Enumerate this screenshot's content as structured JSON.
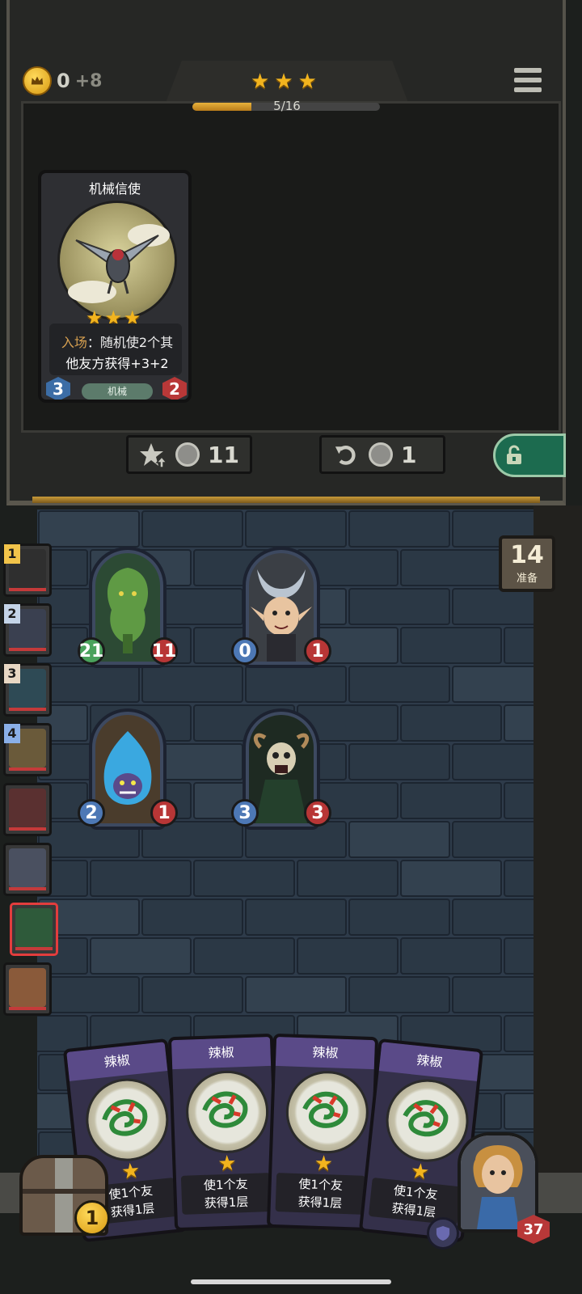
{
  "header": {
    "gold_current": "0",
    "gold_income": "+8",
    "tier_stars": 3,
    "tier_progress_text": "5/16",
    "tier_progress_fraction": 0.3125
  },
  "featured_card": {
    "name": "机械信使",
    "stars": 3,
    "desc_keyword": "入场",
    "desc_line1_rest": "：随机使2个其",
    "desc_line2": "他友方获得+3+2",
    "tribe": "机械",
    "attack": "3",
    "health": "2"
  },
  "shop_buttons": {
    "upgrade_cost": "11",
    "refresh_cost": "1"
  },
  "board": {
    "minions": [
      {
        "attack": "21",
        "health": "11",
        "art": "tree-monster"
      },
      {
        "attack": "0",
        "health": "1",
        "art": "horned-elf"
      },
      {
        "attack": "2",
        "health": "1",
        "art": "blue-flame-demon"
      },
      {
        "attack": "3",
        "health": "3",
        "art": "skull-reaper"
      }
    ],
    "prep_count": "14",
    "prep_label": "准备"
  },
  "opponents": [
    {
      "rank": "1",
      "color": "#2f2f2f"
    },
    {
      "rank": "2",
      "color": "#3a4050"
    },
    {
      "rank": "3",
      "color": "#2e4a55"
    },
    {
      "rank": "4",
      "color": "#6a5a3a"
    },
    {
      "rank": "",
      "color": "#5a3030"
    },
    {
      "rank": "",
      "color": "#4a5060"
    },
    {
      "rank": "",
      "color": "#2e5a3a"
    },
    {
      "rank": "",
      "color": "#8a5a3a"
    }
  ],
  "hand": [
    {
      "name": "辣椒",
      "desc1": "使1个友",
      "desc2": "获得1层"
    },
    {
      "name": "辣椒",
      "desc1": "使1个友",
      "desc2": "获得1层"
    },
    {
      "name": "辣椒",
      "desc1": "使1个友",
      "desc2": "获得1层"
    },
    {
      "name": "辣椒",
      "desc1": "使1个友",
      "desc2": "获得1层"
    }
  ],
  "chest_coins": "1",
  "hero_health": "37",
  "colors": {
    "gold": "#f2b41e",
    "health_red": "#b83838",
    "attack_blue": "#4d78b5",
    "attack_green": "#4aa25c",
    "board_bg": "#2e3b4a",
    "lock_green": "#1c6b4f"
  }
}
